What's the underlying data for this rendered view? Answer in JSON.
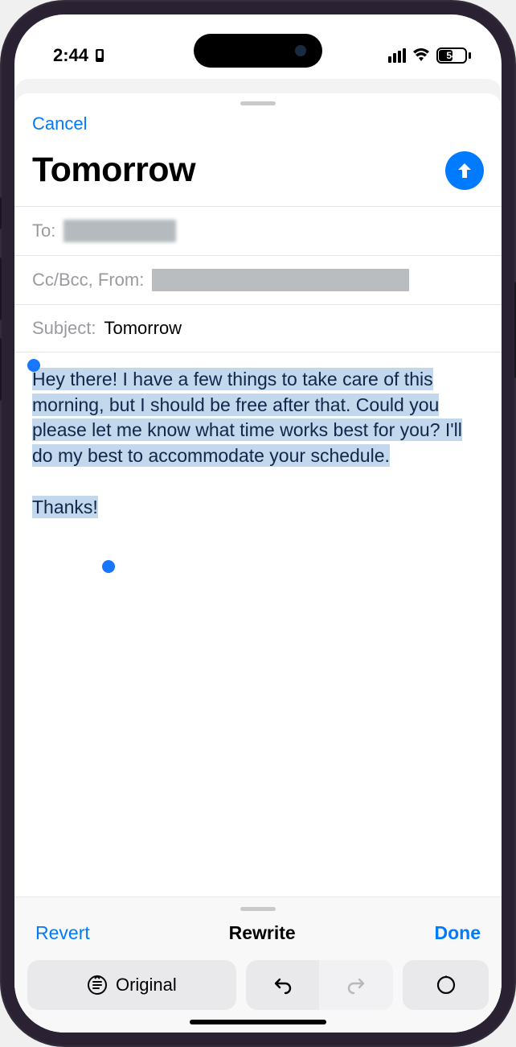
{
  "status": {
    "time": "2:44",
    "battery": "54",
    "battery_fill_pct": 54
  },
  "compose": {
    "cancel": "Cancel",
    "title": "Tomorrow",
    "to_label": "To:",
    "ccbcc_label": "Cc/Bcc, From:",
    "subject_label": "Subject:",
    "subject_value": "Tomorrow",
    "body_para1": "Hey there! I have a few things to take care of this morning, but I should be free after that. Could you please let me know what time works best for you? I'll do my best to accommodate your schedule.",
    "body_para2": "Thanks!"
  },
  "panel": {
    "revert": "Revert",
    "title": "Rewrite",
    "done": "Done",
    "original": "Original"
  },
  "colors": {
    "accent": "#007aff",
    "annotation": "#e2302d"
  }
}
